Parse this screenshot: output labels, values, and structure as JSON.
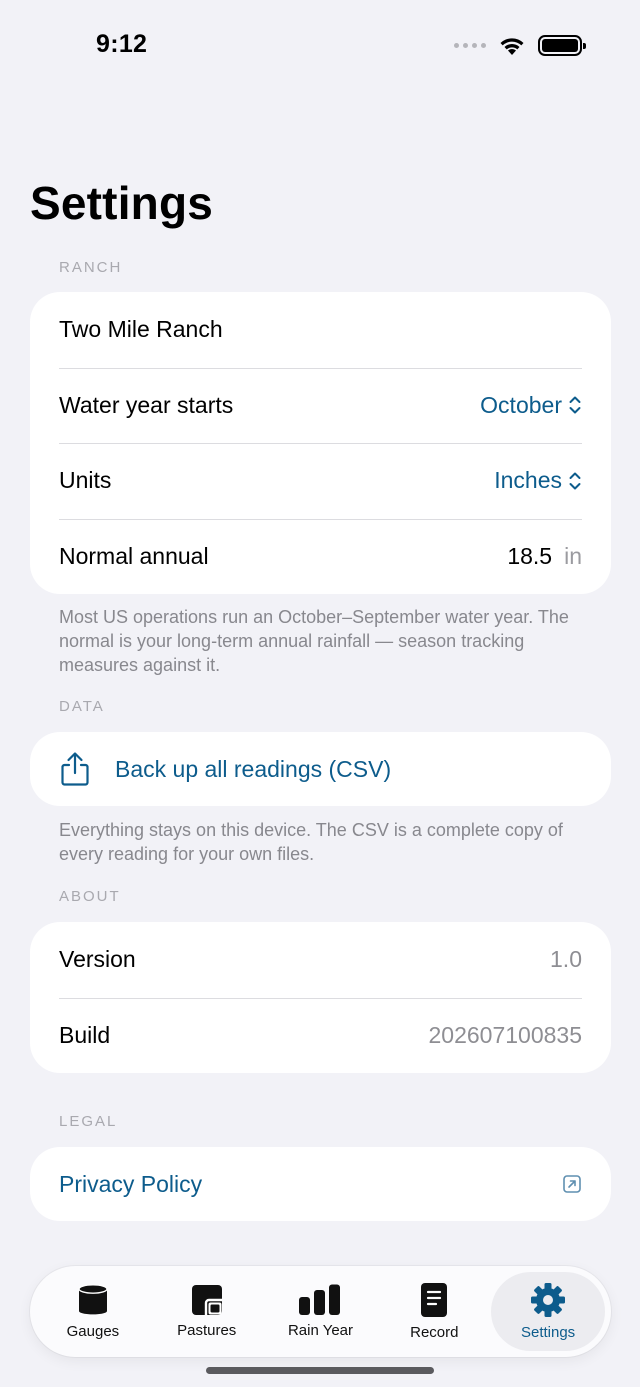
{
  "status": {
    "time": "9:12"
  },
  "page_title": "Settings",
  "ranch": {
    "header": "RANCH",
    "name": "Two Mile Ranch",
    "water_year_label": "Water year starts",
    "water_year_value": "October",
    "units_label": "Units",
    "units_value": "Inches",
    "normal_label": "Normal annual",
    "normal_value": "18.5",
    "normal_unit": "in",
    "footnote": "Most US operations run an October–September water year. The normal is your long-term annual rainfall — season tracking measures against it."
  },
  "data": {
    "header": "DATA",
    "backup_label": "Back up all readings (CSV)",
    "footnote": "Everything stays on this device. The CSV is a complete copy of every reading for your own files."
  },
  "about": {
    "header": "ABOUT",
    "version_label": "Version",
    "version_value": "1.0",
    "build_label": "Build",
    "build_value": "202607100835"
  },
  "legal": {
    "header": "LEGAL",
    "privacy_label": "Privacy Policy"
  },
  "tabs": [
    {
      "label": "Gauges",
      "icon": "gauge-cylinder-icon"
    },
    {
      "label": "Pastures",
      "icon": "pastures-icon"
    },
    {
      "label": "Rain Year",
      "icon": "bar-chart-icon"
    },
    {
      "label": "Record",
      "icon": "record-document-icon"
    },
    {
      "label": "Settings",
      "icon": "gear-icon"
    }
  ],
  "colors": {
    "accent": "#0d5c8c",
    "background": "#f2f2f7",
    "card": "#ffffff",
    "secondary_text": "#8e8e93"
  }
}
